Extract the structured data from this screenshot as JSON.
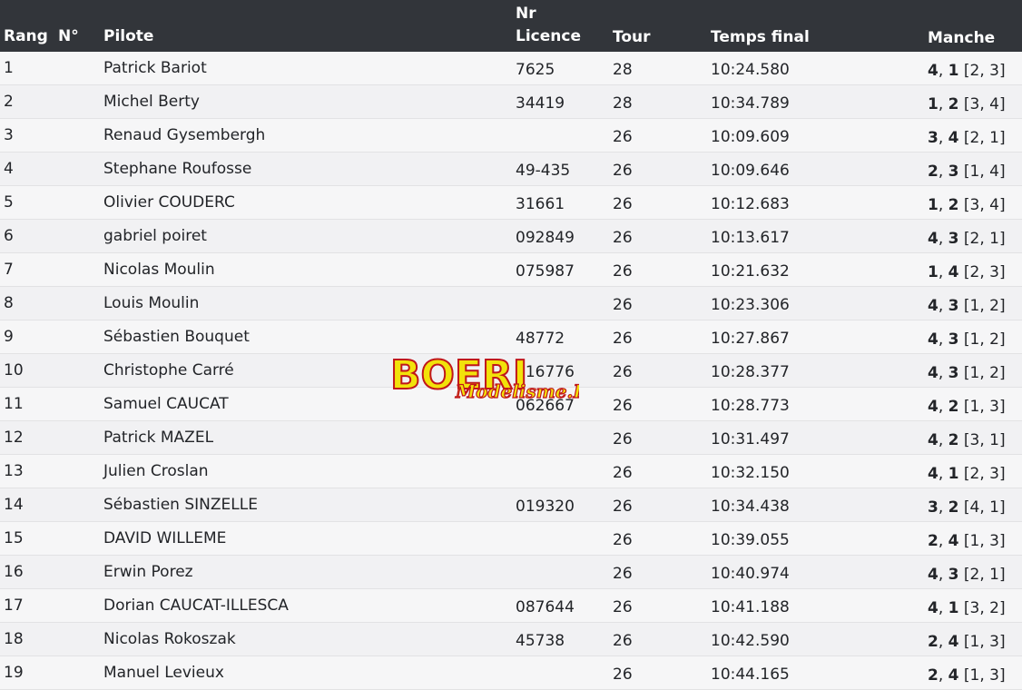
{
  "header": {
    "rang": "Rang",
    "numero": "N°",
    "pilote": "Pilote",
    "licence_line1": "Nr",
    "licence_line2": "Licence",
    "tour": "Tour",
    "temps": "Temps final",
    "manche": "Manche"
  },
  "rows": [
    {
      "rang": "1",
      "pilote": "Patrick Bariot",
      "licence": "7625",
      "tour": "28",
      "temps": "10:24.580",
      "m1": "4",
      "m2": "1",
      "rest": "[2, 3]"
    },
    {
      "rang": "2",
      "pilote": "Michel Berty",
      "licence": "34419",
      "tour": "28",
      "temps": "10:34.789",
      "m1": "1",
      "m2": "2",
      "rest": "[3, 4]"
    },
    {
      "rang": "3",
      "pilote": "Renaud Gysembergh",
      "licence": "",
      "tour": "26",
      "temps": "10:09.609",
      "m1": "3",
      "m2": "4",
      "rest": "[2, 1]"
    },
    {
      "rang": "4",
      "pilote": "Stephane Roufosse",
      "licence": "49-435",
      "tour": "26",
      "temps": "10:09.646",
      "m1": "2",
      "m2": "3",
      "rest": "[1, 4]"
    },
    {
      "rang": "5",
      "pilote": "Olivier COUDERC",
      "licence": "31661",
      "tour": "26",
      "temps": "10:12.683",
      "m1": "1",
      "m2": "2",
      "rest": "[3, 4]"
    },
    {
      "rang": "6",
      "pilote": "gabriel poiret",
      "licence": "092849",
      "tour": "26",
      "temps": "10:13.617",
      "m1": "4",
      "m2": "3",
      "rest": "[2, 1]"
    },
    {
      "rang": "7",
      "pilote": "Nicolas Moulin",
      "licence": "075987",
      "tour": "26",
      "temps": "10:21.632",
      "m1": "1",
      "m2": "4",
      "rest": "[2, 3]"
    },
    {
      "rang": "8",
      "pilote": "Louis Moulin",
      "licence": "",
      "tour": "26",
      "temps": "10:23.306",
      "m1": "4",
      "m2": "3",
      "rest": "[1, 2]"
    },
    {
      "rang": "9",
      "pilote": "Sébastien Bouquet",
      "licence": "48772",
      "tour": "26",
      "temps": "10:27.867",
      "m1": "4",
      "m2": "3",
      "rest": "[1, 2]"
    },
    {
      "rang": "10",
      "pilote": "Christophe Carré",
      "licence": "016776",
      "tour": "26",
      "temps": "10:28.377",
      "m1": "4",
      "m2": "3",
      "rest": "[1, 2]"
    },
    {
      "rang": "11",
      "pilote": "Samuel CAUCAT",
      "licence": "062667",
      "tour": "26",
      "temps": "10:28.773",
      "m1": "4",
      "m2": "2",
      "rest": "[1, 3]"
    },
    {
      "rang": "12",
      "pilote": "Patrick MAZEL",
      "licence": "",
      "tour": "26",
      "temps": "10:31.497",
      "m1": "4",
      "m2": "2",
      "rest": "[3, 1]"
    },
    {
      "rang": "13",
      "pilote": "Julien Croslan",
      "licence": "",
      "tour": "26",
      "temps": "10:32.150",
      "m1": "4",
      "m2": "1",
      "rest": "[2, 3]"
    },
    {
      "rang": "14",
      "pilote": "Sébastien SINZELLE",
      "licence": "019320",
      "tour": "26",
      "temps": "10:34.438",
      "m1": "3",
      "m2": "2",
      "rest": "[4, 1]"
    },
    {
      "rang": "15",
      "pilote": "DAVID WILLEME",
      "licence": "",
      "tour": "26",
      "temps": "10:39.055",
      "m1": "2",
      "m2": "4",
      "rest": "[1, 3]"
    },
    {
      "rang": "16",
      "pilote": "Erwin Porez",
      "licence": "",
      "tour": "26",
      "temps": "10:40.974",
      "m1": "4",
      "m2": "3",
      "rest": "[2, 1]"
    },
    {
      "rang": "17",
      "pilote": "Dorian CAUCAT-ILLESCA",
      "licence": "087644",
      "tour": "26",
      "temps": "10:41.188",
      "m1": "4",
      "m2": "1",
      "rest": "[3, 2]"
    },
    {
      "rang": "18",
      "pilote": "Nicolas Rokoszak",
      "licence": "45738",
      "tour": "26",
      "temps": "10:42.590",
      "m1": "2",
      "m2": "4",
      "rest": "[1, 3]"
    },
    {
      "rang": "19",
      "pilote": "Manuel Levieux",
      "licence": "",
      "tour": "26",
      "temps": "10:44.165",
      "m1": "2",
      "m2": "4",
      "rest": "[1, 3]"
    }
  ],
  "watermark": {
    "text_main": "BOERI",
    "text_sub": "Modelisme.Fr",
    "color_main": "#f2e20a",
    "color_sub": "#f2e20a",
    "outline": "#c0161a"
  }
}
